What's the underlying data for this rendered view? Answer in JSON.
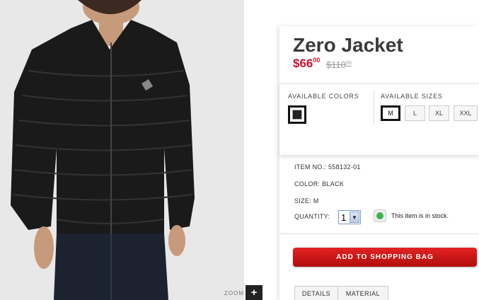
{
  "product": {
    "title": "Zero Jacket",
    "price_main": "$66",
    "price_cents": "00",
    "old_price_main": "$110",
    "old_price_cents": "00"
  },
  "options": {
    "colors_label": "AVAILABLE COLORS",
    "sizes_label": "AVAILABLE SIZES",
    "colors": [
      {
        "name": "black",
        "hex": "#222222",
        "selected": true
      }
    ],
    "sizes": [
      {
        "label": "M",
        "selected": true
      },
      {
        "label": "L",
        "selected": false
      },
      {
        "label": "XL",
        "selected": false
      },
      {
        "label": "XXL",
        "selected": false
      }
    ]
  },
  "details": {
    "item_no": "ITEM NO.: 558132-01",
    "color": "COLOR: BLACK",
    "size": "SIZE: M",
    "quantity_label": "QUANTITY:",
    "quantity_value": "1",
    "stock_text": "This item is in stock."
  },
  "actions": {
    "add_to_bag": "ADD TO SHOPPING BAG"
  },
  "tabs": [
    {
      "label": "DETAILS"
    },
    {
      "label": "MATERIAL"
    }
  ],
  "zoom": {
    "label": "ZOOM",
    "icon": "plus-icon"
  },
  "colors": {
    "accent_red": "#c8102e",
    "button_red": "#d41a1a",
    "stock_green": "#3cb54a"
  }
}
